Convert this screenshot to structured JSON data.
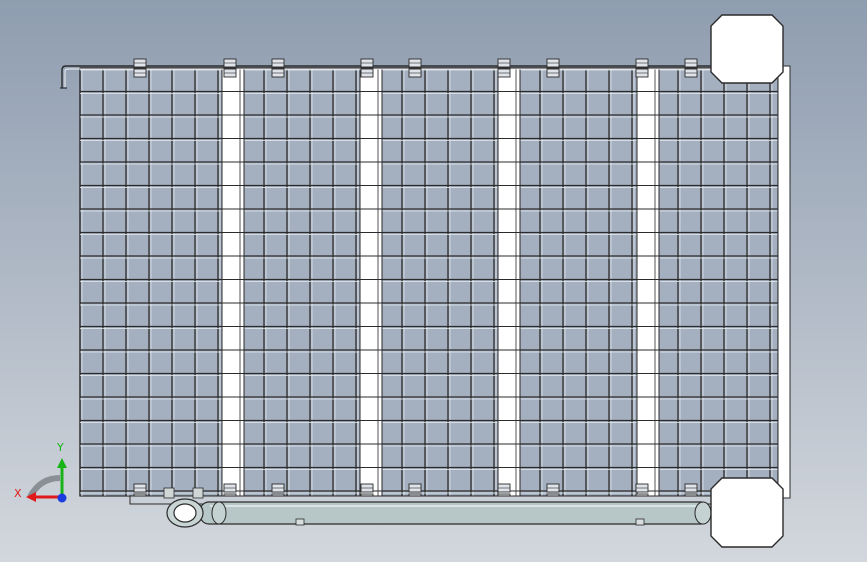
{
  "axes": {
    "x_label": "X",
    "y_label": "Y",
    "x_color": "#e01a1a",
    "y_color": "#17b317",
    "z_color": "#1a3be0"
  },
  "colors": {
    "viewport_top": "#8f9db0",
    "viewport_bottom": "#d3d7dd",
    "mesh_line": "#2b2b2b",
    "mesh_cell": "#a4afbf",
    "slat": "#ffffff",
    "roller": "#b7c6c6",
    "bracket": "#ffffff"
  },
  "icons": {
    "triad": "coordinate-triad-icon",
    "rotate": "rotate-view-icon"
  }
}
